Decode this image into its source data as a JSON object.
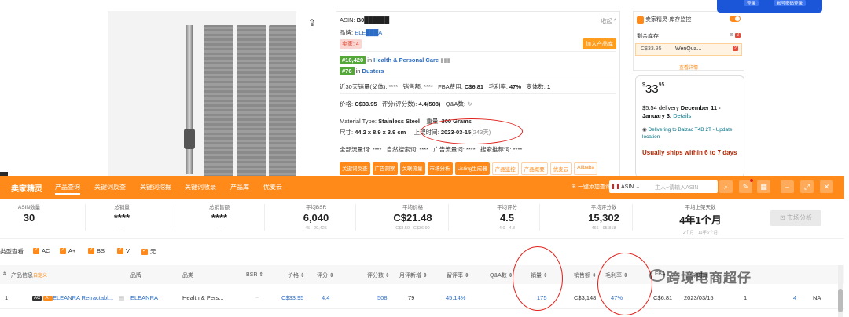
{
  "info": {
    "asin_label": "ASIN:",
    "asin_value": "B0██████",
    "fold": "收起",
    "brand_label": "品牌:",
    "brand_value": "ELE███A",
    "seller_tag": "卖家: 4",
    "add_btn": "加入产品库",
    "rank1_num": "#16,420",
    "rank1_in": "in",
    "rank1_cat": "Health & Personal Care",
    "rank2_num": "#76",
    "rank2_in": "in",
    "rank2_cat": "Dusters",
    "r1_sales30_label": "近30天销量(父体):",
    "r1_sales30": "****",
    "r1_revenue_label": "销售额:",
    "r1_revenue": "****",
    "r1_fba_label": "FBA费用:",
    "r1_fba": "C$6.81",
    "r1_margin_label": "毛利率:",
    "r1_margin": "47%",
    "r1_variants_label": "变体数:",
    "r1_variants": "1",
    "r2_price_label": "价格:",
    "r2_price": "C$33.95",
    "r2_rating_label": "评分(评分数):",
    "r2_rating": "4.4(508)",
    "r2_qa_label": "Q&A数:",
    "r3_material_label": "Material Type:",
    "r3_material": "Stainless Steel",
    "r3_weight_label": "重量:",
    "r3_weight": "300 Grams",
    "r4_size_label": "尺寸:",
    "r4_size": "44.2 x 8.9 x 3.9 cm",
    "r4_date_label": "上架时间:",
    "r4_date": "2023-03-15",
    "r4_days": "(243天)",
    "r5_a_label": "全部流量词:",
    "r5_a": "****",
    "r5_b_label": "自然搜索词:",
    "r5_b": "****",
    "r5_c_label": "广告流量词:",
    "r5_c": "****",
    "r5_d_label": "搜索推荐词:",
    "r5_d": "****",
    "chips_on": [
      "关键词反查",
      "广告洞察",
      "关联流量",
      "市场分析",
      "Listing生成器"
    ],
    "chips_off": [
      "产品监控",
      "产品概要",
      "优麦云",
      "Alibaba"
    ]
  },
  "panel": {
    "header": "卖家精灵·库存监控",
    "stock_label": "剩余库存",
    "stock_count": "2",
    "row_price": "C$33.95",
    "row_seller": "WenQua...",
    "row_count": "2",
    "more": "查看详情"
  },
  "buybox": {
    "price_whole": "33",
    "price_cents": "95",
    "price_symbol": "$",
    "delivery_pre": "$5.54 delivery",
    "delivery_date": "December 11 - January 3.",
    "details": "Details",
    "location": "Delivering to Balzac T4B 2T - Update location",
    "ship": "Usually ships within 6 to 7 days"
  },
  "login": {
    "btn1": "登录",
    "btn2": "帐号密码登录"
  },
  "toolbar": {
    "side": ">",
    "brand": "卖家精灵",
    "nav": [
      "产品查询",
      "关键词反查",
      "关键词挖掘",
      "关键词收录",
      "产品库",
      "优麦云"
    ],
    "oneclick": "一键添加查询",
    "market": "ASIN",
    "search_placeholder": "主人~请输入ASIN"
  },
  "stats": [
    {
      "label": "ASIN数量",
      "value": "30",
      "sub": ""
    },
    {
      "label": "总销量",
      "value": "****",
      "sub": "----"
    },
    {
      "label": "总销售额",
      "value": "****",
      "sub": "----"
    },
    {
      "label": "平均BSR",
      "value": "6,040",
      "sub": "45 · 20,425"
    },
    {
      "label": "平均价格",
      "value": "C$21.48",
      "sub": "C$8.59 · C$36.90"
    },
    {
      "label": "平均评分",
      "value": "4.5",
      "sub": "4.0 · 4.8"
    },
    {
      "label": "平均评分数",
      "value": "15,302",
      "sub": "466 · 95,818"
    },
    {
      "label": "平均上架天数",
      "value": "4年1个月",
      "sub": "2个月 · 11年6个月"
    }
  ],
  "market_btn": "市场分析",
  "filters": {
    "label": "类型查看",
    "items": [
      "AC",
      "A+",
      "BS",
      "V",
      "无"
    ]
  },
  "table": {
    "headers": [
      "#",
      "产品信息",
      "自定义",
      "品牌",
      "品类",
      "BSR",
      "价格",
      "评分",
      "评分数",
      "月评新增",
      "留评率",
      "Q&A数",
      "销量",
      "销售额",
      "毛利率",
      "FBA",
      "上架时间"
    ],
    "row": {
      "index": "1",
      "badge1": "AC",
      "badge2": "A+",
      "title": "ELEANRA Retractabl...",
      "brand": "ELEANRA",
      "category": "Health & Pers...",
      "price": "C$33.95",
      "rating": "4.4",
      "reviews": "508",
      "monthly_reviews": "79",
      "review_rate": "45.14%",
      "sales": "175",
      "revenue": "C$3,148",
      "margin": "47%",
      "fba": "C$6.81",
      "date": "2023/03/15",
      "variants": "1",
      "sellers": "4",
      "extra": "NA"
    }
  },
  "watermark": "跨境电商超仔",
  "colors": {
    "accent": "#ff8a1a",
    "link": "#2b6cc4",
    "annotation": "#e0211b",
    "rank": "#54a837"
  }
}
